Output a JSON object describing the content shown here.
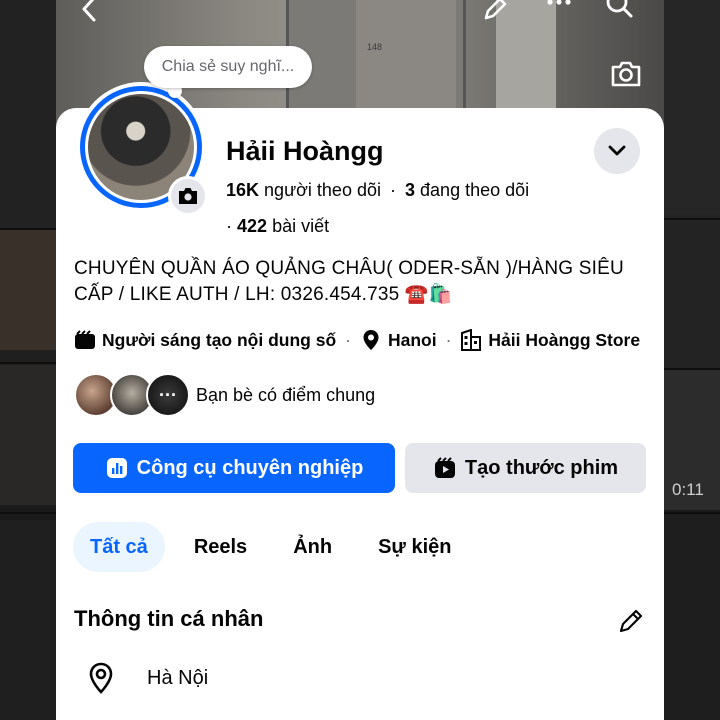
{
  "cover": {
    "door_number": "148"
  },
  "composer_bubble": "Chia sẻ suy nghĩ...",
  "profile": {
    "name": "Hảii Hoàngg",
    "followers_count": "16K",
    "followers_label": "người theo dõi",
    "following_count": "3",
    "following_label": "đang theo dõi",
    "posts_count": "422",
    "posts_label": "bài viết",
    "bio": "CHUYÊN QUẦN ÁO QUẢNG CHÂU( ODER-SẴN )/HÀNG SIÊU CẤP / LIKE AUTH / LH: 0326.454.735 ☎️🛍️"
  },
  "meta": {
    "category": "Người sáng tạo nội dung số",
    "location": "Hanoi",
    "store": "Hảii Hoàngg Store"
  },
  "mutual_friends": {
    "label": "Bạn bè có điểm chung",
    "more": "···"
  },
  "buttons": {
    "pro_tools": "Công cụ chuyên nghiệp",
    "create_reel": "Tạo thước phim"
  },
  "tabs": [
    {
      "label": "Tất cả",
      "active": true
    },
    {
      "label": "Reels",
      "active": false
    },
    {
      "label": "Ảnh",
      "active": false
    },
    {
      "label": "Sự kiện",
      "active": false
    }
  ],
  "personal_info": {
    "title": "Thông tin cá nhân",
    "location": "Hà Nội"
  },
  "background_video_time": "0:11",
  "colors": {
    "accent": "#0866ff",
    "tab_active_bg": "#ebf5ff",
    "secondary_button": "#e4e6eb"
  }
}
